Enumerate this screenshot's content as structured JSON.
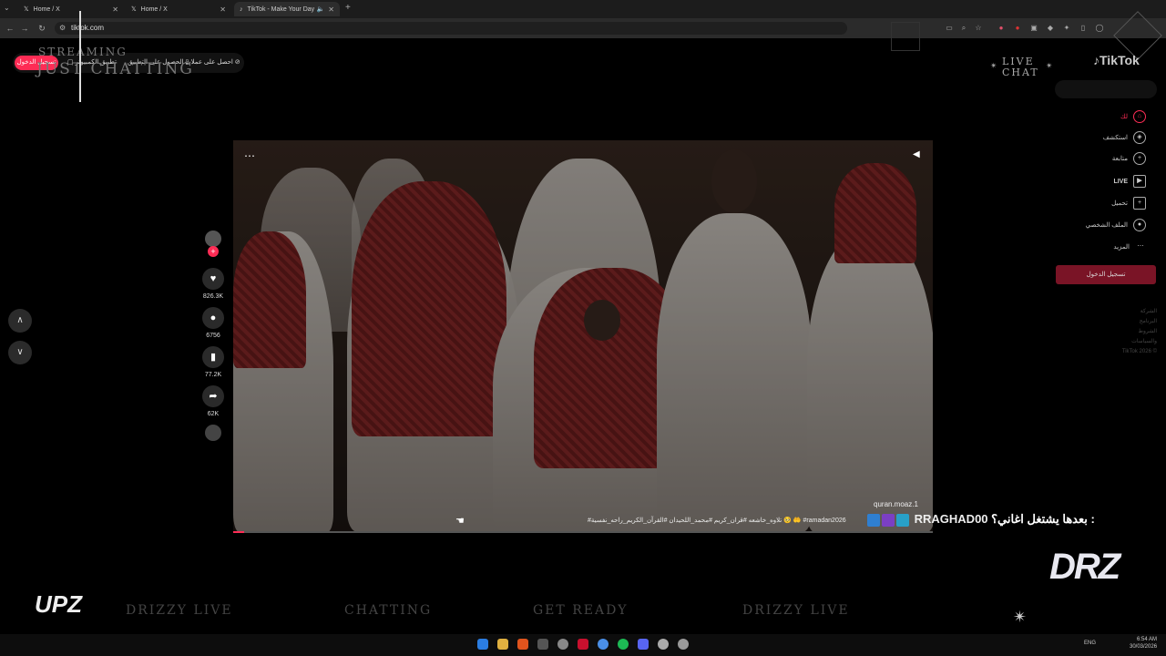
{
  "browser": {
    "tabs": [
      {
        "title": "Home / X"
      },
      {
        "title": "Home / X"
      },
      {
        "title": "TikTok - Make Your Day"
      }
    ],
    "new_tab": "+",
    "url": "tiktok.com"
  },
  "overlay": {
    "stream_title": "STREAMING",
    "stream_subtitle": "JUST CHATTING",
    "live_chat": "LIVE CHAT",
    "bottom_words": [
      "DRIZZY LIVE",
      "CHATTING",
      "GET READY",
      "DRIZZY LIVE"
    ],
    "logo_left": "UPZ",
    "logo_right": "DRZ"
  },
  "tiktok": {
    "logo": "TikTok",
    "top": {
      "signin": "تسجيل الدخول",
      "items": [
        "تطبيق الكمبيوتر",
        "الحصول على التطبيق",
        "احصل على عملات"
      ]
    },
    "sidebar": {
      "items": [
        "لك",
        "استكشف",
        "متابعة",
        "LIVE",
        "تحميل",
        "الملف الشخصي",
        "المزيد"
      ],
      "login": "تسجيل الدخول",
      "footer": [
        "الشركة",
        "البرنامج",
        "الشروط والسياسات",
        "TikTok 2026 ©"
      ]
    },
    "actions": {
      "likes": "826.3K",
      "comments": "6756",
      "saves": "77.2K",
      "shares": "62K"
    },
    "video": {
      "author": "quran.moaz.1",
      "caption": "#تلاوه_خاشعه #قران_كريم #محمد_اللحيدان #القرآن_الكريم_راحه_نفسية 🥺 🤲 #ramadan2026",
      "progress": 0.015
    }
  },
  "chat": {
    "username": "RRAGHAD00",
    "message": "بعدها يشتغل اغاني؟ : "
  },
  "taskbar": {
    "lang": "ENG",
    "time": "6:54 AM",
    "date": "30/03/2026"
  },
  "colors": {
    "accent": "#fe2c55",
    "background": "#000000"
  }
}
